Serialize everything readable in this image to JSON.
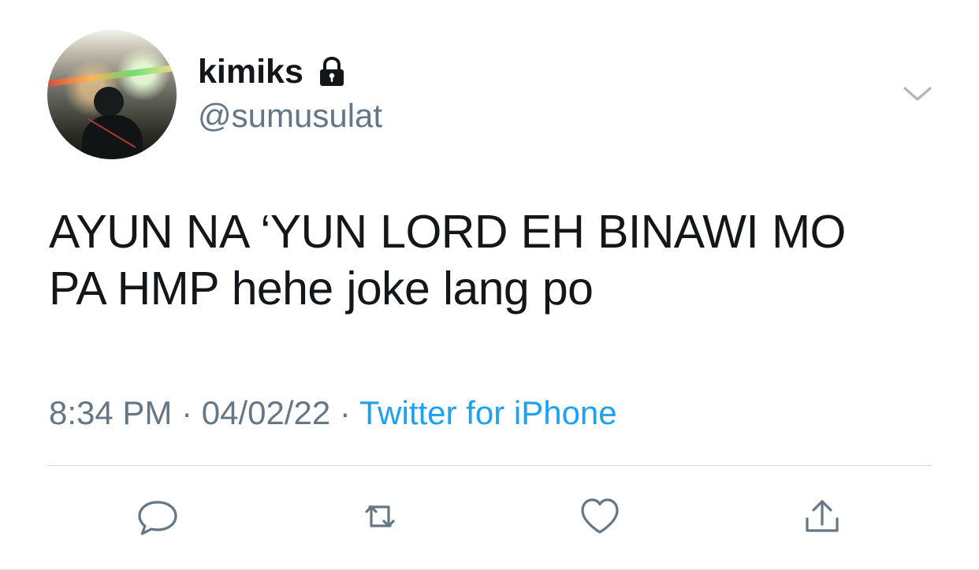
{
  "profile": {
    "display_name": "kimiks",
    "handle": "@sumusulat",
    "avatar_icon": "profile-photo",
    "lock_icon": "lock-icon"
  },
  "tweet": {
    "line1": "AYUN NA ‘YUN LORD EH BINAWI MO",
    "line2": "PA HMP hehe joke lang po"
  },
  "meta": {
    "time": "8:34 PM",
    "separator1": " · ",
    "date": "04/02/22",
    "separator2": " · ",
    "source": "Twitter for iPhone"
  },
  "actions": [
    {
      "icon": "reply-icon"
    },
    {
      "icon": "retweet-icon"
    },
    {
      "icon": "like-icon"
    },
    {
      "icon": "share-icon"
    }
  ],
  "colors": {
    "text": "#14171a",
    "secondary": "#657786",
    "link": "#1da1f2",
    "divider": "#d4dce3"
  }
}
